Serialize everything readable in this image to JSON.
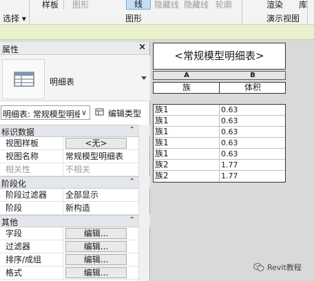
{
  "ribbon": {
    "select_label": "选择",
    "select_arrow": "▾",
    "sample_label": "样板",
    "graphics_dim": "图形",
    "line_label": "线",
    "hidden_line_1": "隐藏线",
    "hidden_line_2": "隐藏线",
    "outline_label": "轮廓",
    "graphics_group_label": "图形",
    "render_label": "渲染",
    "library_label": "库",
    "presentation_group_label": "演示视图"
  },
  "properties": {
    "title": "属性",
    "close_glyph": "×",
    "type_name": "明细表",
    "selector_text": "明细表: 常规模型明细表",
    "selector_chevron": "∨",
    "edit_type_label": "编辑类型",
    "sections": [
      {
        "title": "标识数据",
        "rows": [
          {
            "key": "视图样板",
            "value": "<无>",
            "button": true
          },
          {
            "key": "视图名称",
            "value": "常规模型明细表",
            "button": false
          },
          {
            "key": "相关性",
            "value": "不相关",
            "button": false,
            "dim": true
          }
        ]
      },
      {
        "title": "阶段化",
        "rows": [
          {
            "key": "阶段过滤器",
            "value": "全部显示",
            "button": false
          },
          {
            "key": "阶段",
            "value": "新构造",
            "button": false
          }
        ]
      },
      {
        "title": "其他",
        "rows": [
          {
            "key": "字段",
            "value": "编辑...",
            "button": true
          },
          {
            "key": "过滤器",
            "value": "编辑...",
            "button": true
          },
          {
            "key": "排序/成组",
            "value": "编辑...",
            "button": true
          },
          {
            "key": "格式",
            "value": "编辑...",
            "button": true
          }
        ]
      }
    ],
    "collapse_glyph": "⌃"
  },
  "schedule": {
    "title": "<常规模型明细表>",
    "col_letters": [
      "A",
      "B"
    ],
    "headers": [
      "族",
      "体积"
    ],
    "rows": [
      {
        "family": "族1",
        "volume": "0.63"
      },
      {
        "family": "族1",
        "volume": "0.63"
      },
      {
        "family": "族1",
        "volume": "0.63"
      },
      {
        "family": "族1",
        "volume": "0.63"
      },
      {
        "family": "族1",
        "volume": "0.63"
      },
      {
        "family": "族2",
        "volume": "1.77"
      },
      {
        "family": "族2",
        "volume": "1.77"
      }
    ]
  },
  "watermark": {
    "text": "Revit教程"
  },
  "colors": {
    "ribbon_bg": "#f3f3f3",
    "ribbon_strip": "#e8f0cc",
    "active_button": "#c4dcf5",
    "view_bg": "#d9d9d9",
    "section_header": "#e3e6ea"
  }
}
